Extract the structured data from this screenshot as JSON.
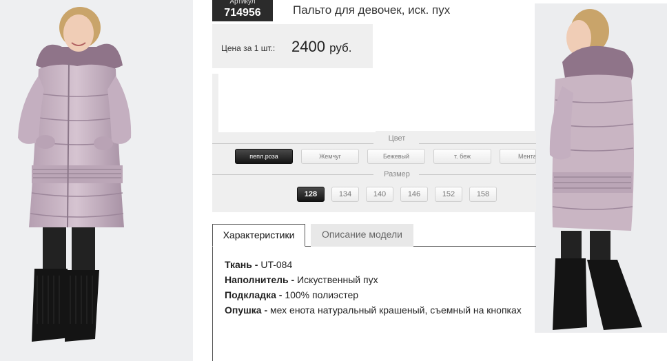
{
  "product": {
    "sku_label": "Артикул",
    "sku_value": "714956",
    "title": "Пальто для девочек, иск. пух",
    "price_label": "Цена за 1 шт.:",
    "price_value": "2400",
    "price_currency": "руб."
  },
  "options": {
    "color_heading": "Цвет",
    "colors": [
      {
        "label": "пепл.роза",
        "selected": true
      },
      {
        "label": "Жемчуг",
        "selected": false
      },
      {
        "label": "Бежевый",
        "selected": false
      },
      {
        "label": "т. беж",
        "selected": false
      },
      {
        "label": "Мента",
        "selected": false
      }
    ],
    "size_heading": "Размер",
    "sizes": [
      {
        "label": "128",
        "selected": true
      },
      {
        "label": "134",
        "selected": false
      },
      {
        "label": "140",
        "selected": false
      },
      {
        "label": "146",
        "selected": false
      },
      {
        "label": "152",
        "selected": false
      },
      {
        "label": "158",
        "selected": false
      }
    ]
  },
  "tabs": [
    {
      "label": "Характеристики",
      "active": true
    },
    {
      "label": "Описание модели",
      "active": false
    }
  ],
  "specs": [
    {
      "name": "Ткань",
      "value": "UT-084"
    },
    {
      "name": "Наполнитель",
      "value": "Искуственный пух"
    },
    {
      "name": "Подкладка",
      "value": "100% полиэстер"
    },
    {
      "name": "Опушка",
      "value": "мех енота натуральный крашеный, съемный на кнопках"
    }
  ],
  "colors": {
    "coat": "#c9b5c3",
    "fur": "#8f7489",
    "boots": "#141414",
    "panel": "#efefef",
    "active_button": "#1e1e1e"
  }
}
